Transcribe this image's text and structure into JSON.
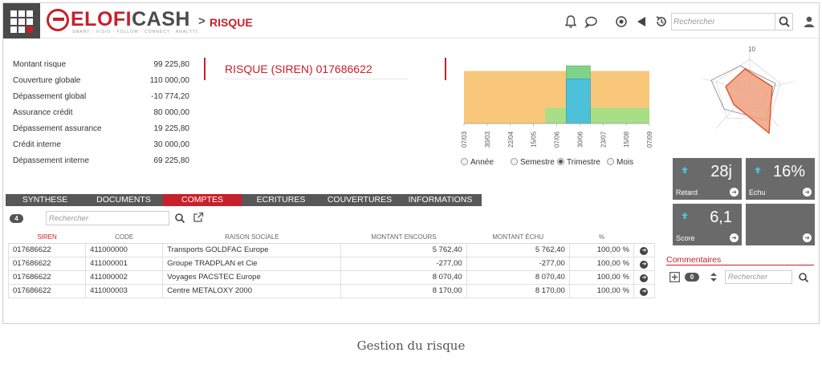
{
  "header": {
    "logo_text_left": "ELOFI",
    "logo_text_right": "CASH",
    "logo_tagline": "SMART · VISIO · FOLLOW · CONNECT · ANALYTI",
    "breadcrumb_chevron": ">",
    "breadcrumb": "RISQUE",
    "search_placeholder": "Rechercher",
    "icons": [
      "bell-icon",
      "chat-icon",
      "target-icon",
      "back-arrow-icon",
      "history-icon",
      "search-icon",
      "user-icon"
    ]
  },
  "summary": [
    {
      "label": "Montant risque",
      "value": "99 225,80"
    },
    {
      "label": "Couverture globale",
      "value": "110 000,00"
    },
    {
      "label": "Dépassement global",
      "value": "-10 774,20"
    },
    {
      "label": "Assurance crédit",
      "value": "80 000,00"
    },
    {
      "label": "Dépassement assurance",
      "value": "19 225,80"
    },
    {
      "label": "Crédit interne",
      "value": "30 000,00"
    },
    {
      "label": "Dépassement interne",
      "value": "69 225,80"
    }
  ],
  "risk_title": "RISQUE (SIREN) 017686622",
  "chart_data": {
    "type": "area",
    "categories": [
      "07/03",
      "30/03",
      "22/04",
      "15/05",
      "07/06",
      "30/06",
      "23/07",
      "15/08",
      "07/09"
    ],
    "series": [
      {
        "values": [
          100,
          100,
          100,
          100,
          100,
          100,
          100,
          100,
          100
        ],
        "color": "#f9c77a"
      },
      {
        "values": [
          0,
          0,
          0,
          0,
          30,
          30,
          30,
          30,
          30
        ],
        "color": "#a8de86"
      },
      {
        "values": [
          0,
          0,
          0,
          0,
          0,
          110,
          0,
          0,
          0
        ],
        "color": "#7ed28a"
      },
      {
        "values": [
          0,
          0,
          0,
          0,
          0,
          85,
          0,
          0,
          0
        ],
        "color": "#4cc1d9"
      }
    ],
    "ylim": [
      0,
      110
    ],
    "grid": false
  },
  "period": {
    "options": [
      "Année",
      "Semestre",
      "Trimestre",
      "Mois"
    ],
    "selected": "Trimestre"
  },
  "radar": {
    "axis_max_label": "10"
  },
  "kpis": [
    {
      "label": "Retard",
      "value": "28j",
      "trend": "up"
    },
    {
      "label": "Echu",
      "value": "16%",
      "trend": "up"
    },
    {
      "label": "Score",
      "value": "6,1",
      "trend": "up"
    },
    {
      "label": "",
      "value": "",
      "trend": ""
    }
  ],
  "tabs": [
    {
      "label": "SYNTHESE",
      "active": false
    },
    {
      "label": "DOCUMENTS",
      "active": false
    },
    {
      "label": "COMPTES",
      "active": true
    },
    {
      "label": "ECRITURES",
      "active": false
    },
    {
      "label": "COUVERTURES",
      "active": false
    },
    {
      "label": "INFORMATIONS",
      "active": false
    }
  ],
  "table": {
    "count": "4",
    "search_placeholder": "Rechercher",
    "columns": [
      "SIREN",
      "CODE",
      "RAISON SOCIALE",
      "MONTANT ENCOURS",
      "MONTANT ÉCHU",
      "%"
    ],
    "rows": [
      [
        "017686622",
        "411000000",
        "Transports GOLDFAC Europe",
        "5 762,40",
        "5 762,40",
        "100,00 %"
      ],
      [
        "017686622",
        "411000001",
        "Groupe TRADPLAN et Cie",
        "-277,00",
        "-277,00",
        "100,00 %"
      ],
      [
        "017686622",
        "411000002",
        "Voyages PACSTEC Europe",
        "8 070,40",
        "8 070,40",
        "100,00 %"
      ],
      [
        "017686622",
        "411000003",
        "Centre METALOXY 2000",
        "8 170,00",
        "8 170,00",
        "100,00 %"
      ]
    ]
  },
  "comments": {
    "title": "Commentaires",
    "count": "0",
    "search_placeholder": "Rechercher"
  },
  "caption": "Gestion du risque",
  "colors": {
    "brand_red": "#c8202a",
    "dark_grey": "#575757",
    "tile_grey": "#6a6a6a",
    "accent_blue": "#4cc1d9"
  }
}
